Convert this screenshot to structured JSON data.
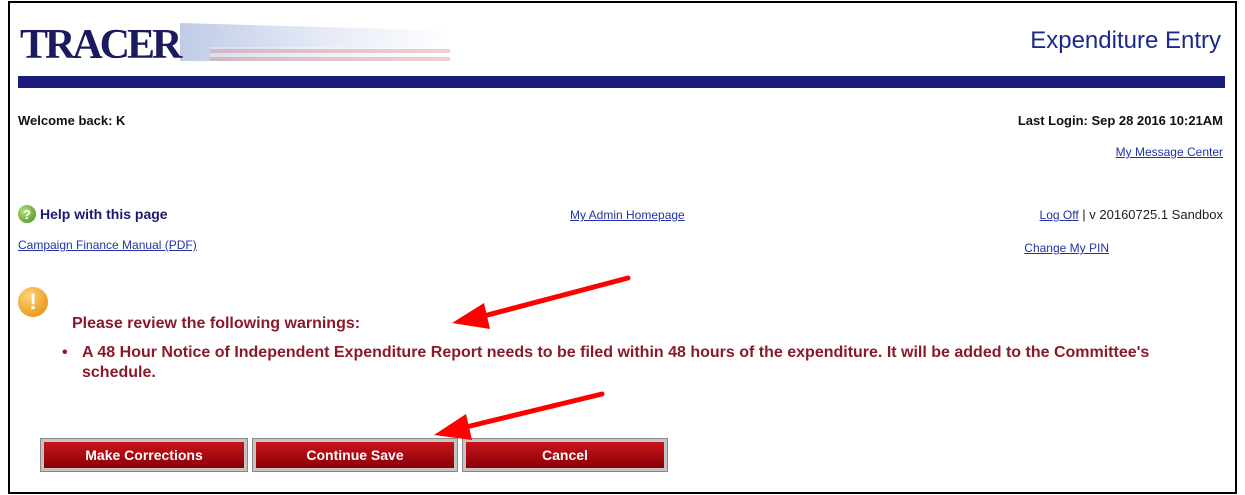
{
  "header": {
    "logo_text": "TRACER",
    "page_title": "Expenditure Entry"
  },
  "user": {
    "welcome": "Welcome back: K",
    "last_login": "Last Login: Sep 28 2016 10:21AM",
    "message_center": "My Message Center"
  },
  "nav": {
    "help": "Help with this page",
    "manual": "Campaign Finance Manual (PDF)",
    "admin_home": "My Admin Homepage",
    "log_off": "Log Off",
    "version": " | v 20160725.1 Sandbox",
    "change_pin": "Change My PIN"
  },
  "warnings": {
    "title": "Please review the following warnings:",
    "items": [
      "A 48 Hour Notice of Independent Expenditure Report needs to be filed within 48 hours of the expenditure. It will be added to the Committee's schedule."
    ]
  },
  "buttons": {
    "make_corrections": "Make Corrections",
    "continue_save": "Continue Save",
    "cancel": "Cancel"
  },
  "colors": {
    "header_bar": "#1c1c7c",
    "warning_text": "#8a1a2a",
    "button_red": "#b0101a",
    "annotation_arrow": "#ff0000"
  },
  "icons": [
    "help-icon",
    "warning-icon",
    "annotation-arrow"
  ]
}
